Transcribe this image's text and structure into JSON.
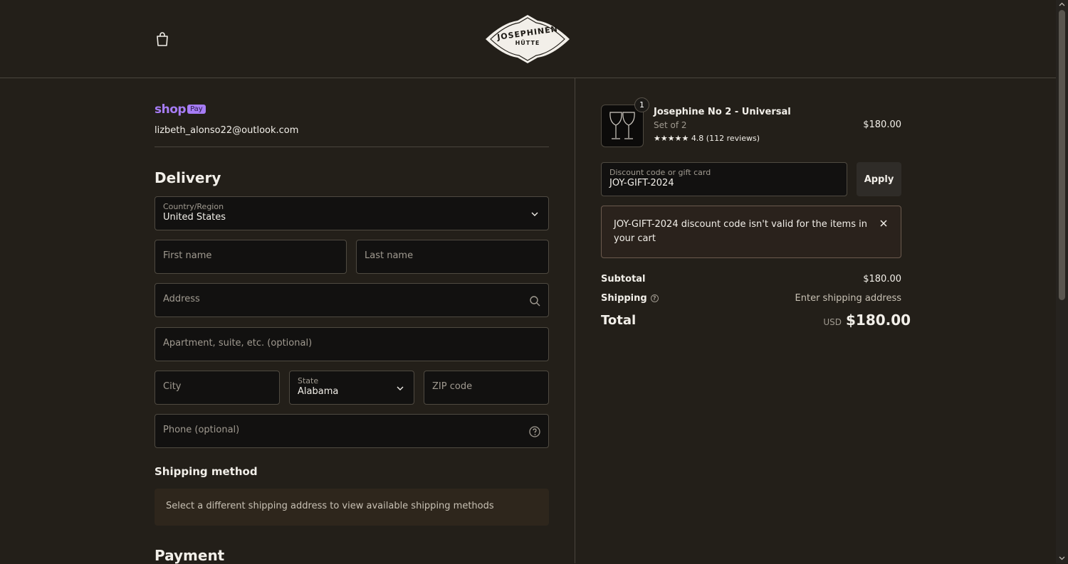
{
  "header": {
    "logo_text_top": "JOSEPHINEN",
    "logo_text_bottom": "HÜTTE",
    "cart_icon": "shopping-bag-icon"
  },
  "express": {
    "brand": "shop",
    "pay_badge": "Pay",
    "email": "lizbeth_alonso22@outlook.com"
  },
  "delivery": {
    "heading": "Delivery",
    "country": {
      "label": "Country/Region",
      "value": "United States",
      "icon": "chevron-down-icon"
    },
    "first_name": {
      "placeholder": "First name"
    },
    "last_name": {
      "placeholder": "Last name"
    },
    "address": {
      "placeholder": "Address",
      "icon": "search-icon"
    },
    "apartment": {
      "placeholder": "Apartment, suite, etc. (optional)"
    },
    "city": {
      "placeholder": "City"
    },
    "state": {
      "label": "State",
      "value": "Alabama",
      "icon": "chevron-down-icon"
    },
    "zip": {
      "placeholder": "ZIP code"
    },
    "phone": {
      "placeholder": "Phone (optional)",
      "icon": "help-circle-icon"
    }
  },
  "shipping_method": {
    "heading": "Shipping method",
    "note": "Select a different shipping address to view available shipping methods"
  },
  "payment": {
    "heading": "Payment"
  },
  "summary": {
    "product": {
      "quantity": "1",
      "name": "Josephine No 2 - Universal",
      "variant": "Set of 2",
      "stars": "★★★★★",
      "rating": "4.8 (112 reviews)",
      "price": "$180.00"
    },
    "discount": {
      "label": "Discount code or gift card",
      "value": "JOY-GIFT-2024",
      "apply_label": "Apply"
    },
    "error": {
      "message": "JOY-GIFT-2024 discount code isn't valid for the items in your cart",
      "close_icon": "close-icon"
    },
    "subtotal_label": "Subtotal",
    "subtotal_value": "$180.00",
    "shipping_label": "Shipping",
    "shipping_value": "Enter shipping address",
    "total_label": "Total",
    "total_currency": "USD",
    "total_value": "$180.00"
  },
  "colors": {
    "background": "#231f19",
    "field_bg": "#121110",
    "accent_shop": "#a67cf5",
    "text": "#f2efe9",
    "muted": "#a09a90"
  }
}
